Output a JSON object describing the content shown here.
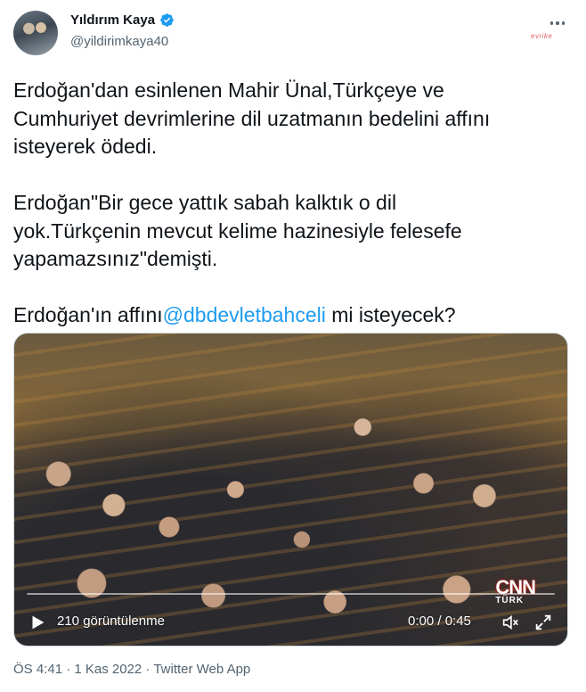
{
  "author": {
    "name": "Yıldırım Kaya",
    "handle": "@yildirimkaya40"
  },
  "watermark": "evrike",
  "tweet": {
    "para1_line1": "Erdoğan'dan esinlenen Mahir Ünal,Türkçeye ve",
    "para1_line2": "Cumhuriyet devrimlerine dil uzatmanın bedelini affını",
    "para1_line3": "isteyerek ödedi.",
    "para2_line1": "Erdoğan\"Bir gece yattık sabah kalktık o dil",
    "para2_line2": "yok.Türkçenin mevcut kelime hazinesiyle felesefe",
    "para2_line3": "yapamazsınız\"demişti.",
    "para3_prefix": "Erdoğan'ın affını",
    "para3_mention": "@dbdevletbahceli",
    "para3_suffix": " mi isteyecek?"
  },
  "video": {
    "views": "210 görüntülenme",
    "time": "0:00 / 0:45",
    "channel_logo": "CNN",
    "channel_sub": "TÜRK"
  },
  "footer": {
    "meta": "ÖS 4:41 · 1 Kas 2022 · Twitter Web App"
  },
  "colors": {
    "accent": "#1d9bf0",
    "muted": "#536471",
    "text": "#0f1419"
  },
  "icons": [
    "verified-badge-icon",
    "more-options-icon",
    "play-icon",
    "volume-icon",
    "fullscreen-icon"
  ]
}
